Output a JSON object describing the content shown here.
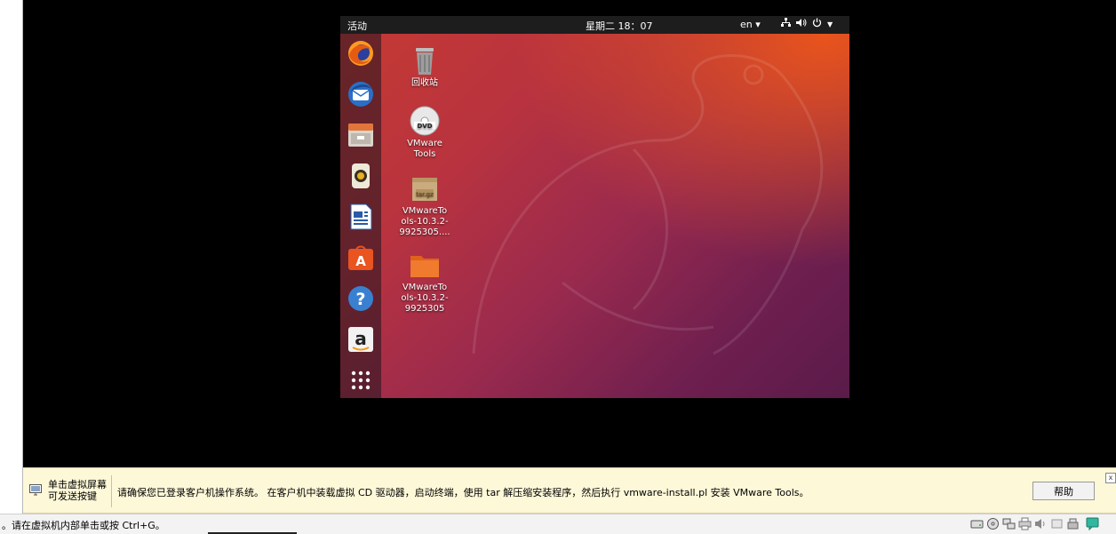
{
  "guest": {
    "topbar": {
      "activities": "活动",
      "clock": "星期二 18：07",
      "language": "en ▾"
    },
    "dock": [
      "firefox-icon",
      "thunderbird-icon",
      "files-icon",
      "rhythmbox-icon",
      "libreoffice-writer-icon",
      "ubuntu-software-icon",
      "help-icon",
      "amazon-icon",
      "show-applications-icon"
    ],
    "desktop_icons": [
      {
        "label": "回收站",
        "icon": "trash-icon"
      },
      {
        "label": "VMware\nTools",
        "icon": "dvd-icon"
      },
      {
        "label": "VMwareTo\nols-10.3.2-\n9925305....",
        "icon": "archive-icon",
        "badge": "tar.gz"
      },
      {
        "label": "VMwareTo\nols-10.3.2-\n9925305",
        "icon": "folder-icon"
      }
    ]
  },
  "infobar": {
    "hint": "单击虚拟屏幕\n可发送按键",
    "message": "请确保您已登录客户机操作系统。 在客户机中装载虚拟 CD 驱动器，启动终端，使用 tar 解压缩安装程序，然后执行 vmware-install.pl 安装 VMware Tools。",
    "help_label": "帮助",
    "close_label": "x"
  },
  "statusbar": {
    "text": "。请在虚拟机内部单击或按 Ctrl+G。",
    "devices": [
      "hard-disk-icon",
      "cdrom-icon",
      "network-icon",
      "printer-icon",
      "sound-icon",
      "usb-icon",
      "display-icon",
      "message-icon"
    ]
  },
  "colors": {
    "ubuntu_orange": "#e95420",
    "topbar": "#1d1d1d",
    "infobar_bg": "#fdf8d8"
  }
}
